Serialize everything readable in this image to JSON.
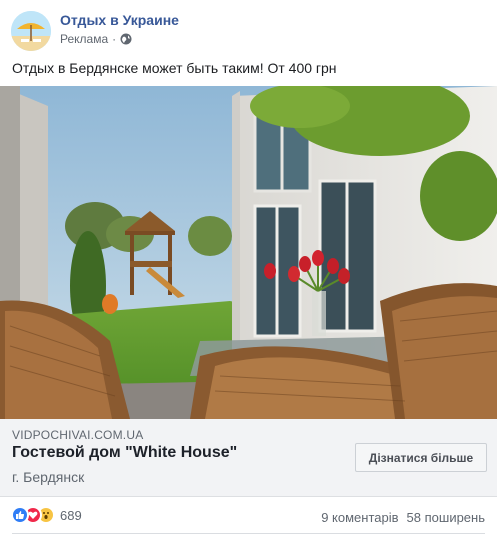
{
  "post": {
    "page_name": "Отдых в Украине",
    "sponsored_label": "Реклама",
    "dot": "·",
    "text": "Отдых в Бердянске может быть таким! От 400 грн"
  },
  "link_preview": {
    "domain": "VIDPOCHIVAI.COM.UA",
    "title": "Гостевой дом \"White House\"",
    "description": "г. Бердянск",
    "cta_label": "Дізнатися більше"
  },
  "engagement": {
    "reactions": [
      "like-icon",
      "love-icon",
      "wow-icon"
    ],
    "reactions_count": "689",
    "comments": "9 коментарів",
    "shares": "58 поширень"
  },
  "colors": {
    "page_name": "#385898",
    "like": "#2f7df6",
    "love": "#f0284a",
    "wow": "#f7c443",
    "link_box_bg": "#f2f3f5"
  }
}
